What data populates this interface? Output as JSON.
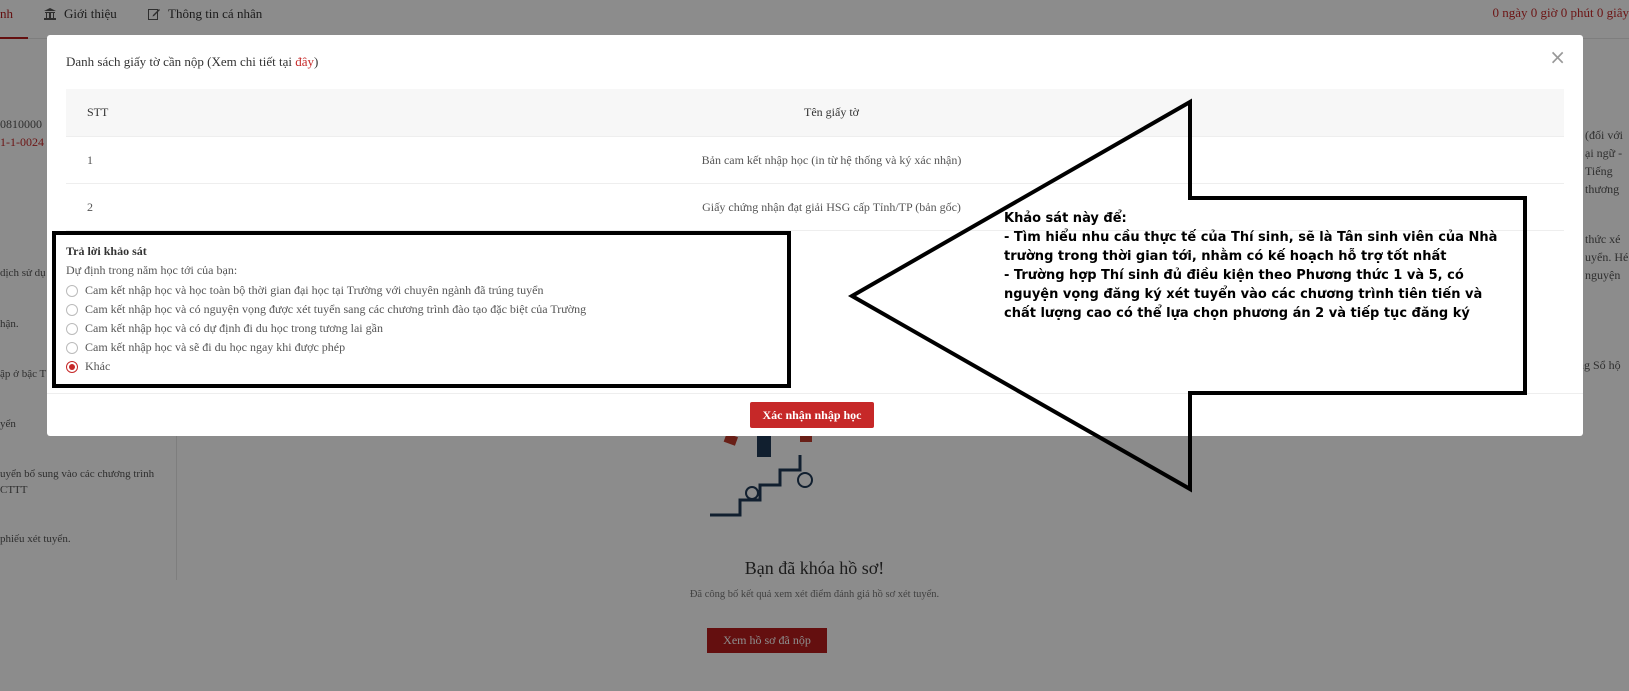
{
  "nav": {
    "active_fragment": "nh",
    "items": [
      {
        "label": "Giới thiệu",
        "icon": "bank-icon"
      },
      {
        "label": "Thông tin cá nhân",
        "icon": "edit-icon"
      }
    ],
    "countdown": "0 ngày 0 giờ 0 phút 0 giây"
  },
  "left_panel": {
    "code_partial": "0810000",
    "id_partial": "1-1-0024",
    "fragments": [
      "dịch sử dụ",
      "hận.",
      "ập ở bậc T",
      "yển",
      "uyển bổ sung vào các chương trình",
      "CTTT",
      "phiếu xét tuyển."
    ]
  },
  "right_panel": {
    "fragments": [
      "(đối với",
      "ại ngữ -",
      "Tiếng",
      "thương",
      "thức xé",
      "uyển. Hé",
      "nguyện",
      "ng Sổ hộ"
    ]
  },
  "locked": {
    "title": "Bạn đã khóa hồ sơ!",
    "subtitle": "Đã công bố kết quả xem xét điểm đánh giá hồ sơ xét tuyển.",
    "view_button": "Xem hồ sơ đã nộp"
  },
  "modal": {
    "title_prefix": "Danh sách giấy tờ cần nộp (Xem chi tiết tại ",
    "title_link": "đây",
    "title_suffix": ")",
    "close": "×",
    "table": {
      "headers": [
        "STT",
        "Tên giấy tờ"
      ],
      "rows": [
        [
          "1",
          "Bản cam kết nhập học (in từ hệ thống và ký xác nhận)"
        ],
        [
          "2",
          "Giấy chứng nhận đạt giải HSG cấp Tỉnh/TP (bản gốc)"
        ]
      ]
    },
    "survey": {
      "title": "Trả lời khảo sát",
      "question": "Dự định trong năm học tới của bạn:",
      "options": [
        {
          "label": "Cam kết nhập học và học toàn bộ thời gian đại học tại Trường với chuyên ngành đã trúng tuyển",
          "selected": false
        },
        {
          "label": "Cam kết nhập học và có nguyện vọng được xét tuyển sang các chương trình đào tạo đặc biệt của Trường",
          "selected": false
        },
        {
          "label": "Cam kết nhập học và có dự định đi du học trong tương lai gần",
          "selected": false
        },
        {
          "label": "Cam kết nhập học và sẽ đi du học ngay khi được phép",
          "selected": false
        },
        {
          "label": "Khác",
          "selected": true
        }
      ]
    },
    "confirm_button": "Xác nhận nhập học"
  },
  "annotation": {
    "lines": [
      "Khảo sát này để:",
      "- Tìm hiểu nhu cầu thực tế của Thí sinh, sẽ là Tân sinh viên của Nhà trường trong thời gian tới, nhằm có kế hoạch hỗ trợ tốt nhất",
      "- Trường hợp Thí sinh đủ điều kiện theo Phương thức 1 và 5, có nguyện vọng đăng ký xét tuyển vào các chương trình tiên tiến và chất lượng cao có thể lựa chọn phương án 2 và tiếp tục đăng ký"
    ]
  },
  "colors": {
    "accent": "#c62828",
    "overlay": "rgba(0,0,0,0.45)"
  }
}
